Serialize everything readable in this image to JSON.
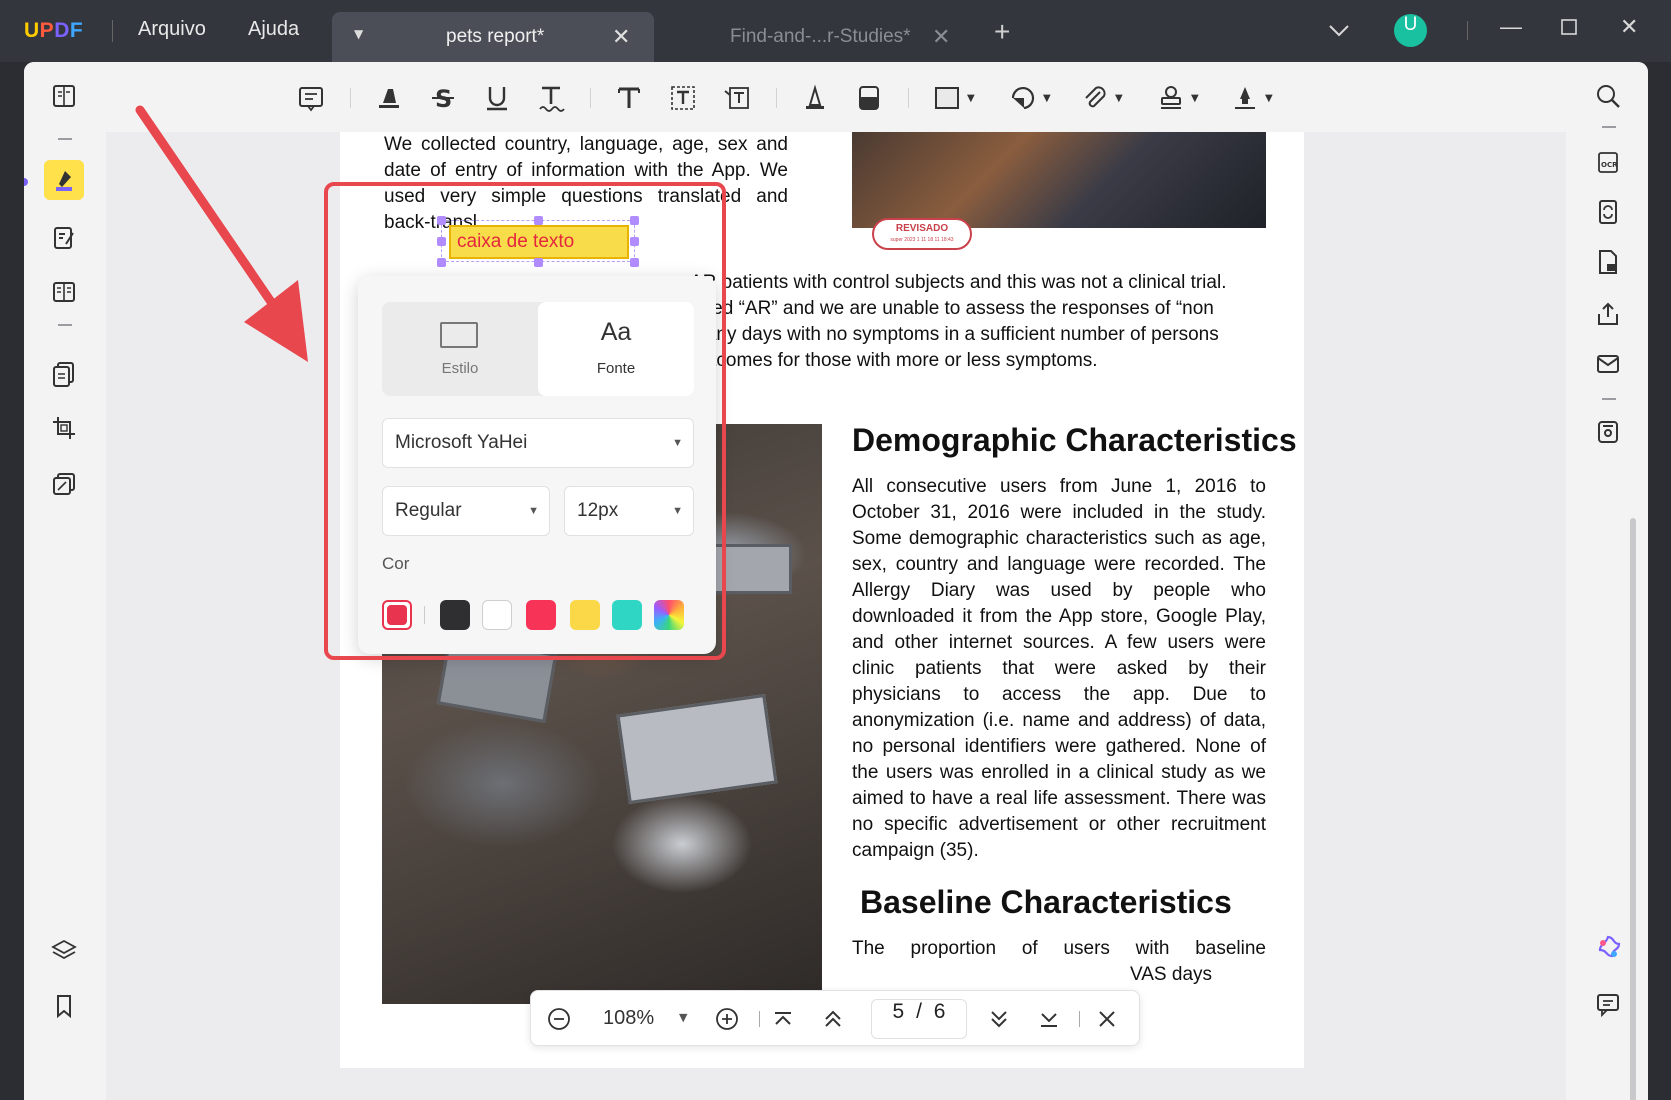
{
  "app": {
    "logo": {
      "u": "U",
      "p": "P",
      "d": "D",
      "f": "F"
    },
    "menu": [
      "Arquivo",
      "Ajuda"
    ],
    "tabs": [
      {
        "title": "pets report*",
        "active": true
      },
      {
        "title": "Find-and-...r-Studies*",
        "active": false
      }
    ],
    "avatar_letter": "U"
  },
  "document": {
    "para1": "We collected country, language, age, sex and date of entry of information with the App. We used very simple questions translated and back-transl",
    "para2_lines": [
      "AR patients with control subjects and this was not a clinical trial.",
      "orted “AR” and we are unable to assess the responses of “non",
      "many days with no symptoms in a sufficient number of persons",
      "outcomes for those with more or less symptoms."
    ],
    "heading_demographic": "Demographic Characteristics",
    "demographic_text": "All consecutive users from June 1, 2016 to October 31, 2016 were included in the study. Some demographic characteristics such as age, sex, country and language were recorded. The Allergy Diary was used by people who downloaded it from the App store, Google Play, and other internet sources. A few users were clinic patients that were asked by their physicians to access the app. Due to anonymization (i.e. name and address) of data, no personal identifiers were gathered. None of the users was enrolled in a clinical study as we aimed to have a real life assessment. There was no specific advertisement or other recruitment campaign (35).",
    "heading_baseline": "Baseline Characteristics",
    "baseline_text_1": "The proportion of users with baseline",
    "baseline_text_2": "VAS days",
    "stamp_title": "REVISADO",
    "stamp_sub": "super 2023 1 11 18 11 18:43"
  },
  "textbox": {
    "content": "caixa de texto"
  },
  "popup": {
    "tabs": [
      {
        "label": "Estilo",
        "selected": false
      },
      {
        "label": "Fonte",
        "selected": true
      }
    ],
    "font_tab_glyph": "Aa",
    "font_family": "Microsoft YaHei",
    "font_weight": "Regular",
    "font_size": "12px",
    "color_label": "Cor",
    "colors": [
      "#e8344f",
      "#2f2f31",
      "#ffffff",
      "#f73458",
      "#fbd847",
      "#2fd6c3",
      "rainbow"
    ],
    "selected_color": "#e8344f"
  },
  "nav": {
    "zoom": "108%",
    "current_page": "5",
    "page_separator": "/",
    "total_pages": "6"
  }
}
